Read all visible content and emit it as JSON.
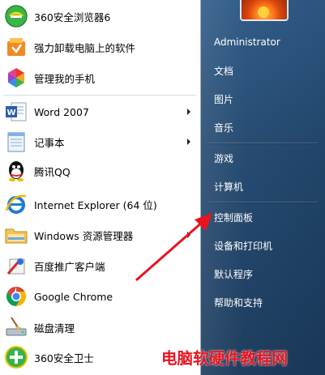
{
  "start_menu": {
    "programs": [
      {
        "label": "360安全浏览器6",
        "icon": "360-browser-icon",
        "has_submenu": false
      },
      {
        "label": "强力卸载电脑上的软件",
        "icon": "uninstall-icon",
        "has_submenu": false
      },
      {
        "label": "管理我的手机",
        "icon": "phone-manager-icon",
        "has_submenu": false
      },
      {
        "label": "Word 2007",
        "icon": "word-icon",
        "has_submenu": true
      },
      {
        "label": "记事本",
        "icon": "notepad-icon",
        "has_submenu": true
      },
      {
        "label": "腾讯QQ",
        "icon": "qq-icon",
        "has_submenu": false
      },
      {
        "label": "Internet Explorer (64 位)",
        "icon": "ie-icon",
        "has_submenu": false
      },
      {
        "label": "Windows 资源管理器",
        "icon": "explorer-icon",
        "has_submenu": true
      },
      {
        "label": "百度推广客户端",
        "icon": "baidu-client-icon",
        "has_submenu": false
      },
      {
        "label": "Google Chrome",
        "icon": "chrome-icon",
        "has_submenu": false
      },
      {
        "label": "磁盘清理",
        "icon": "disk-cleanup-icon",
        "has_submenu": false
      },
      {
        "label": "360安全卫士",
        "icon": "360-guard-icon",
        "has_submenu": false
      }
    ],
    "right_items": [
      {
        "label": "Administrator"
      },
      {
        "label": "文档"
      },
      {
        "label": "图片"
      },
      {
        "label": "音乐"
      },
      {
        "label": "游戏"
      },
      {
        "label": "计算机"
      },
      {
        "label": "控制面板"
      },
      {
        "label": "设备和打印机"
      },
      {
        "label": "默认程序"
      },
      {
        "label": "帮助和支持"
      }
    ]
  },
  "watermark": "电脑软硬件教程网",
  "colors": {
    "right_pane": "#23486f",
    "annotation_arrow": "#e8141e",
    "watermark_text": "#e8141e"
  }
}
